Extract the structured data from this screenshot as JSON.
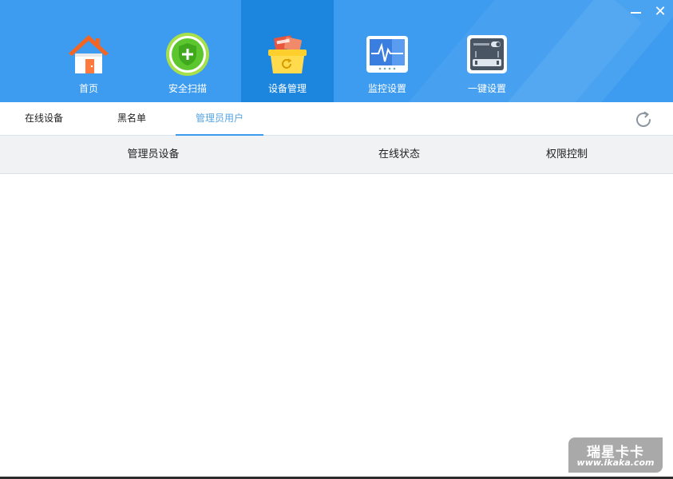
{
  "window": {
    "minimize_icon": "minimize-icon",
    "close_icon": "close-icon",
    "close_glyph": "✕"
  },
  "nav": {
    "items": [
      {
        "label": "首页",
        "icon": "house-icon",
        "active": false
      },
      {
        "label": "安全扫描",
        "icon": "shield-plus-icon",
        "active": false
      },
      {
        "label": "设备管理",
        "icon": "device-basket-icon",
        "active": true
      },
      {
        "label": "监控设置",
        "icon": "monitor-wave-icon",
        "active": false
      },
      {
        "label": "一键设置",
        "icon": "router-panel-icon",
        "active": false
      }
    ]
  },
  "tabs": [
    {
      "label": "在线设备",
      "active": false
    },
    {
      "label": "黑名单",
      "active": false
    },
    {
      "label": "管理员用户",
      "active": true
    }
  ],
  "refresh_icon": "refresh-icon",
  "table": {
    "columns": [
      "管理员设备",
      "在线状态",
      "权限控制"
    ],
    "rows": []
  },
  "watermark": {
    "title": "瑞星卡卡",
    "url": "www.ikaka.com"
  },
  "colors": {
    "header_bg": "#3d9cf0",
    "nav_active_bg": "#1c86df",
    "tab_active_text": "#57a4e0",
    "table_header_bg": "#f1f2f4"
  }
}
